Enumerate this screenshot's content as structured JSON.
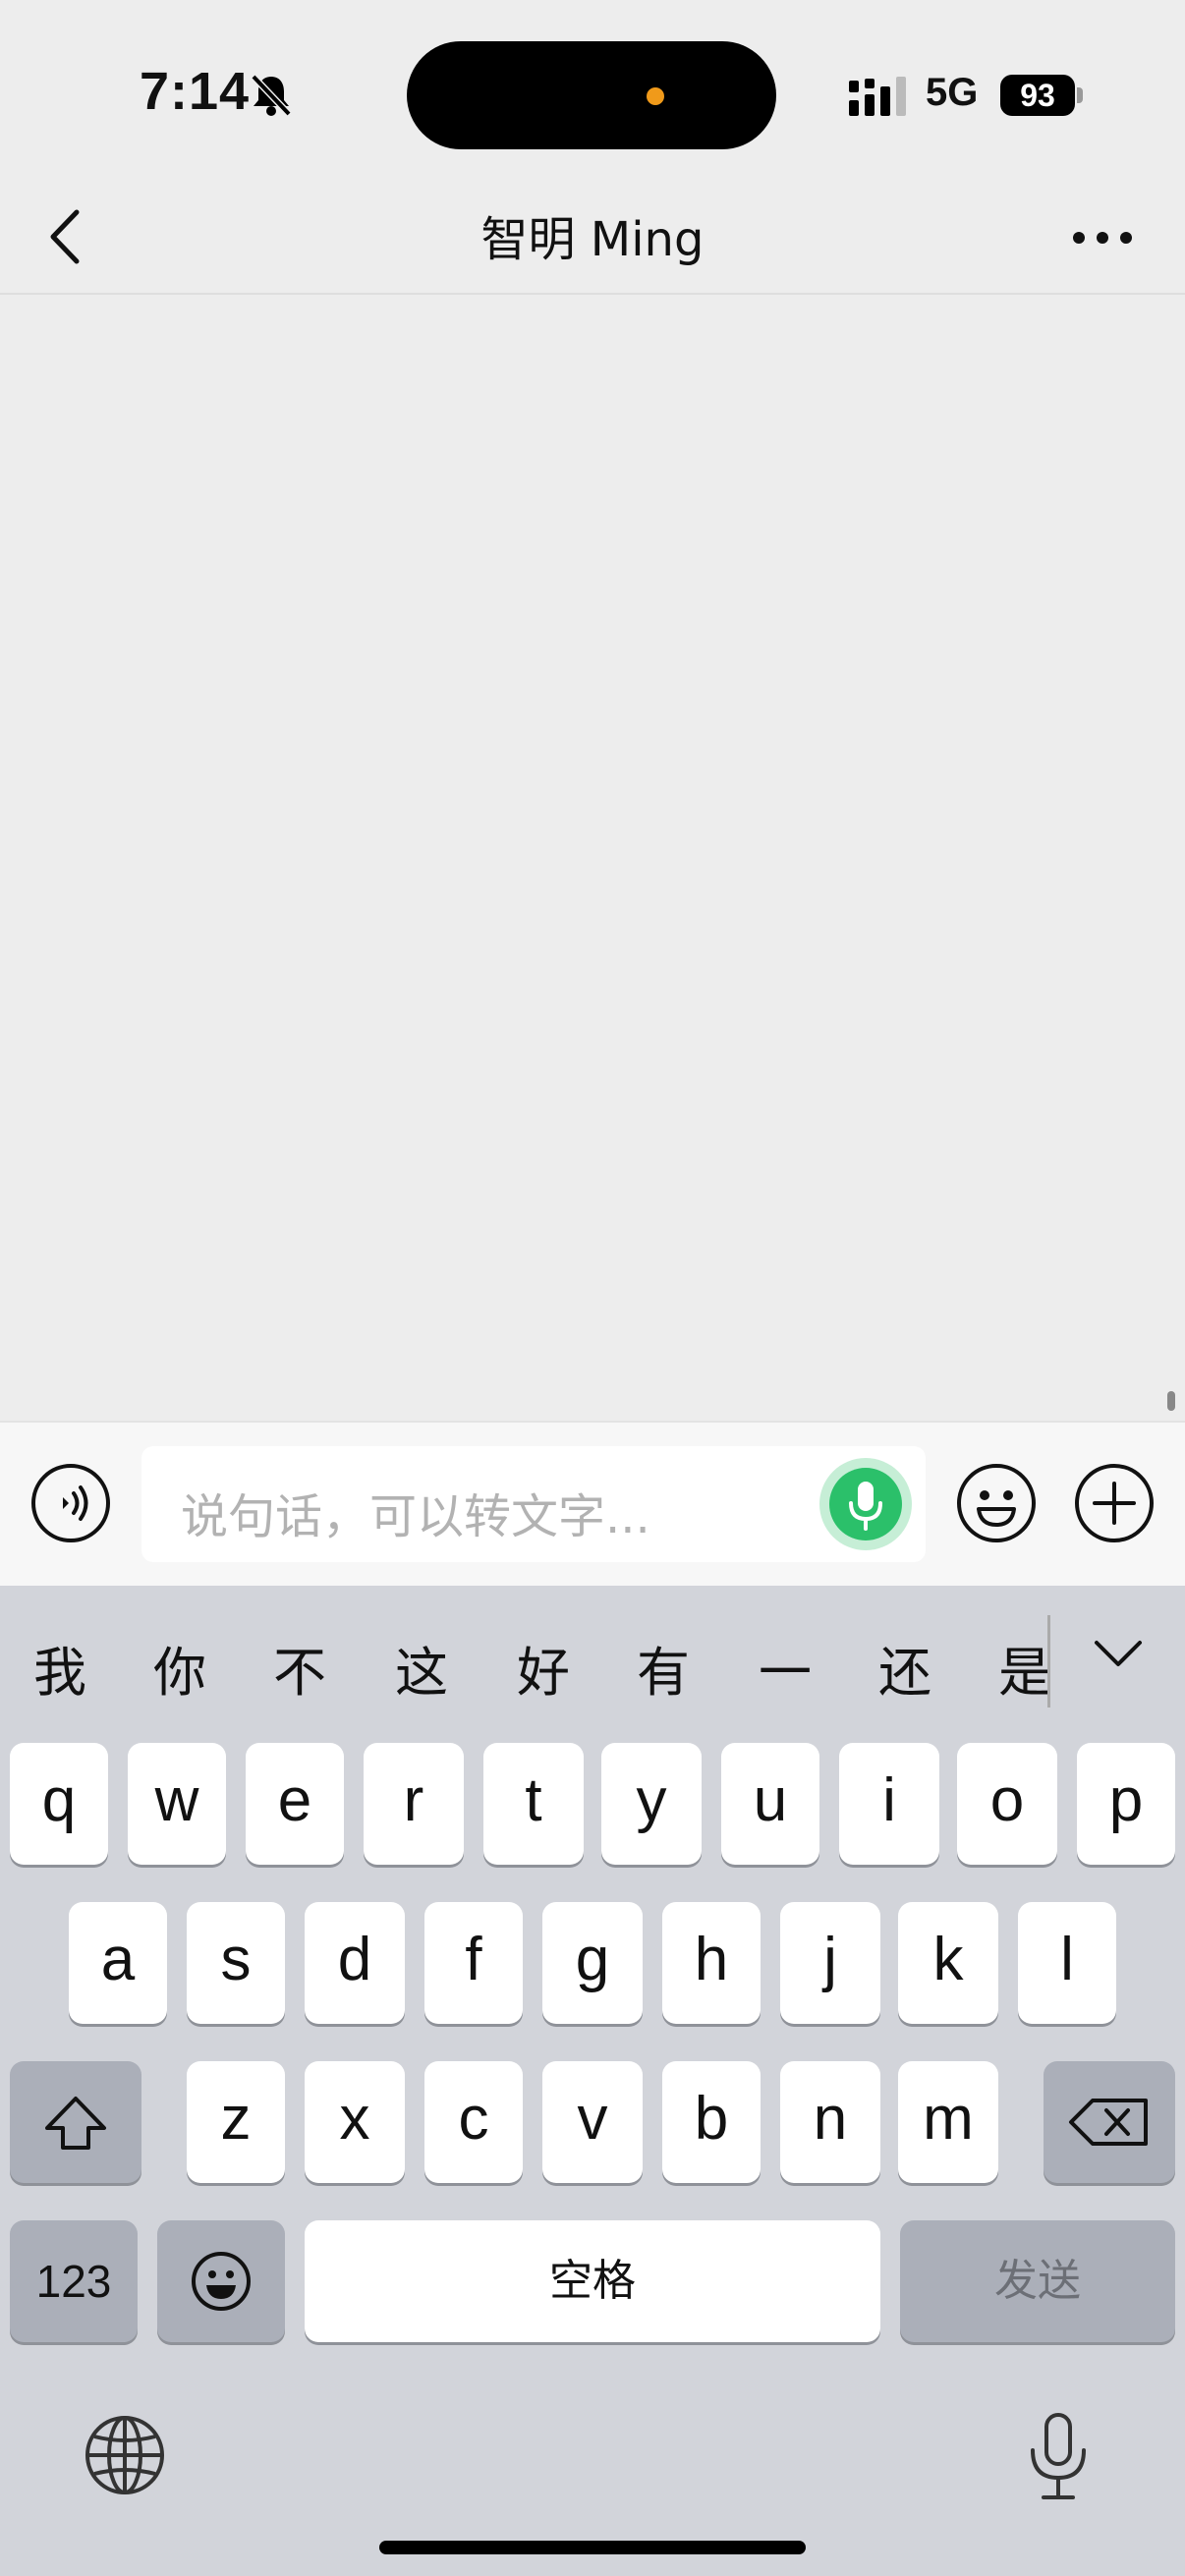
{
  "status_bar": {
    "time": "7:14",
    "network": "5G",
    "battery": "93"
  },
  "nav": {
    "title": "智明 Ming"
  },
  "input": {
    "placeholder": "说句话，可以转文字..."
  },
  "keyboard": {
    "candidates": [
      "我",
      "你",
      "不",
      "这",
      "好",
      "有",
      "一",
      "还",
      "是"
    ],
    "row1": [
      "q",
      "w",
      "e",
      "r",
      "t",
      "y",
      "u",
      "i",
      "o",
      "p"
    ],
    "row2": [
      "a",
      "s",
      "d",
      "f",
      "g",
      "h",
      "j",
      "k",
      "l"
    ],
    "row3": [
      "z",
      "x",
      "c",
      "v",
      "b",
      "n",
      "m"
    ],
    "numbers_label": "123",
    "space_label": "空格",
    "send_label": "发送"
  },
  "colors": {
    "accent": "#2bc06a",
    "background": "#ededed",
    "keyboard_bg": "#d2d4da"
  }
}
